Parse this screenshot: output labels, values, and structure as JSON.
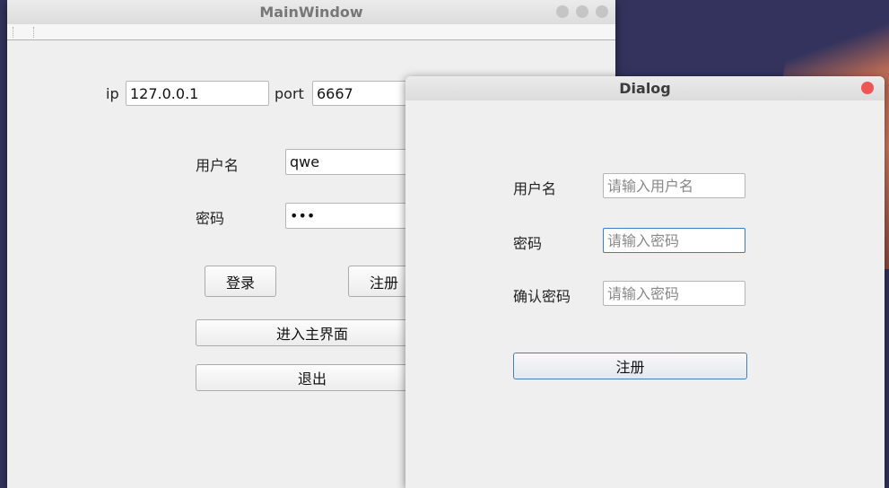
{
  "main": {
    "title": "MainWindow",
    "ip_label": "ip",
    "ip_value": "127.0.0.1",
    "port_label": "port",
    "port_value": "6667",
    "username_label": "用户名",
    "username_value": "qwe",
    "password_label": "密码",
    "password_value": "•••",
    "login": "登录",
    "register": "注册",
    "enter_main": "进入主界面",
    "exit": "退出"
  },
  "dialog": {
    "title": "Dialog",
    "username_label": "用户名",
    "username_placeholder": "请输入用户名",
    "password_label": "密码",
    "password_placeholder": "请输入密码",
    "confirm_label": "确认密码",
    "confirm_placeholder": "请输入密码",
    "register": "注册"
  }
}
